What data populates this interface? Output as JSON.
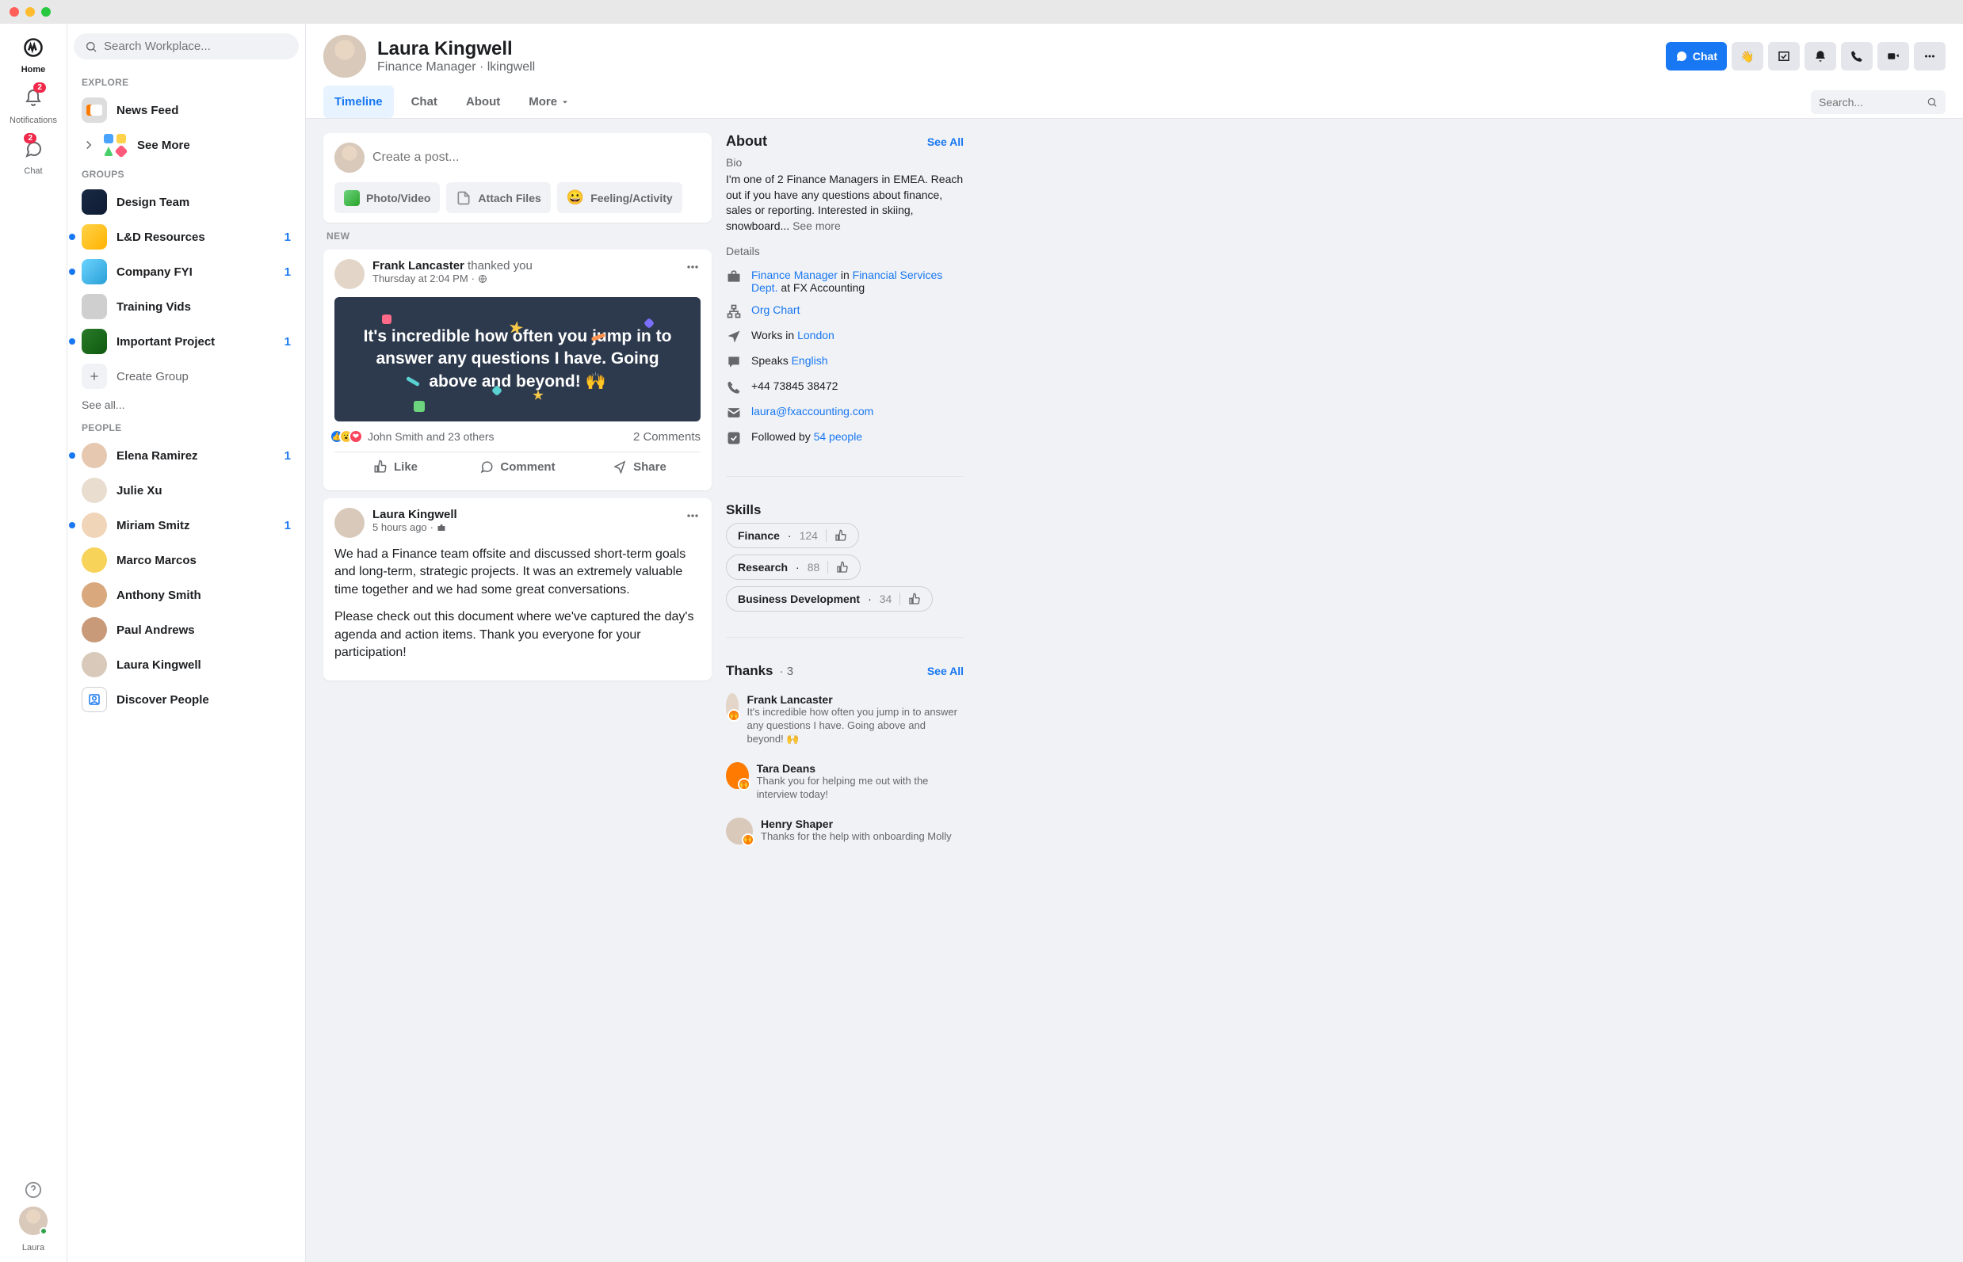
{
  "rail": {
    "home": "Home",
    "notifications": "Notifications",
    "notif_badge": "2",
    "chat": "Chat",
    "chat_badge": "2",
    "user": "Laura"
  },
  "sidebar": {
    "search_placeholder": "Search Workplace...",
    "explore_label": "EXPLORE",
    "newsfeed": "News Feed",
    "seemore": "See More",
    "groups_label": "GROUPS",
    "groups": [
      {
        "name": "Design Team",
        "count": "",
        "dot": false,
        "cls": "c1"
      },
      {
        "name": "L&D Resources",
        "count": "1",
        "dot": true,
        "cls": "c2"
      },
      {
        "name": "Company FYI",
        "count": "1",
        "dot": true,
        "cls": "c3"
      },
      {
        "name": "Training Vids",
        "count": "",
        "dot": false,
        "cls": "c4"
      },
      {
        "name": "Important Project",
        "count": "1",
        "dot": true,
        "cls": "c5"
      }
    ],
    "create_group": "Create Group",
    "see_all": "See all...",
    "people_label": "PEOPLE",
    "people": [
      {
        "name": "Elena Ramirez",
        "count": "1",
        "dot": true,
        "cls": "p1"
      },
      {
        "name": "Julie Xu",
        "count": "",
        "dot": false,
        "cls": "p2"
      },
      {
        "name": "Miriam Smitz",
        "count": "1",
        "dot": true,
        "cls": "p3"
      },
      {
        "name": "Marco Marcos",
        "count": "",
        "dot": false,
        "cls": "p4"
      },
      {
        "name": "Anthony Smith",
        "count": "",
        "dot": false,
        "cls": "p5"
      },
      {
        "name": "Paul Andrews",
        "count": "",
        "dot": false,
        "cls": "p6"
      },
      {
        "name": "Laura Kingwell",
        "count": "",
        "dot": false,
        "cls": "p7"
      }
    ],
    "discover": "Discover People"
  },
  "profile": {
    "name": "Laura Kingwell",
    "subtitle": "Finance Manager · lkingwell",
    "chat_btn": "Chat",
    "tabs": {
      "timeline": "Timeline",
      "chat": "Chat",
      "about": "About",
      "more": "More"
    },
    "search_placeholder": "Search..."
  },
  "composer": {
    "placeholder": "Create a post...",
    "photo": "Photo/Video",
    "attach": "Attach Files",
    "feeling": "Feeling/Activity"
  },
  "new_label": "NEW",
  "post1": {
    "author": "Frank Lancaster",
    "action": " thanked you",
    "time": "Thursday at 2:04 PM",
    "body": "It's incredible how often you jump in to answer any questions I have. Going above and beyond! 🙌",
    "reacts_text": "John Smith and 23 others",
    "comments": "2 Comments",
    "like": "Like",
    "comment": "Comment",
    "share": "Share"
  },
  "post2": {
    "author": "Laura Kingwell",
    "time": "5 hours ago",
    "p1": "We had a Finance team offsite and discussed short-term goals and long-term, strategic projects. It was an extremely valuable time together and we had some great conversations.",
    "p2": "Please check out this document where we've captured the day's agenda and action items. Thank you everyone for your participation!"
  },
  "about": {
    "title": "About",
    "see_all": "See All",
    "bio_label": "Bio",
    "bio": "I'm one of 2 Finance Managers in EMEA. Reach out if you have any questions about finance, sales or reporting. Interested in skiing, snowboard... ",
    "see_more": "See more",
    "details_label": "Details",
    "role_link": "Finance Manager",
    "role_in": " in ",
    "dept_link": "Financial Services Dept.",
    "role_at": " at FX Accounting",
    "org_chart": "Org Chart",
    "works_in": "Works in ",
    "city": "London",
    "speaks": "Speaks ",
    "lang": "English",
    "phone": "+44 73845 38472",
    "email": "laura@fxaccounting.com",
    "followed_by": "Followed by ",
    "followers": "54 people"
  },
  "skills": {
    "title": "Skills",
    "items": [
      {
        "name": "Finance",
        "count": "124"
      },
      {
        "name": "Research",
        "count": "88"
      },
      {
        "name": "Business Development",
        "count": "34"
      }
    ]
  },
  "thanks": {
    "title": "Thanks",
    "count": "3",
    "see_all": "See All",
    "items": [
      {
        "name": "Frank Lancaster",
        "text": "It's incredible how often you jump in to answer any questions I have. Going above and beyond! 🙌"
      },
      {
        "name": "Tara Deans",
        "text": "Thank you for helping me out with the interview today!"
      },
      {
        "name": "Henry Shaper",
        "text": "Thanks for the help with onboarding Molly"
      }
    ]
  }
}
